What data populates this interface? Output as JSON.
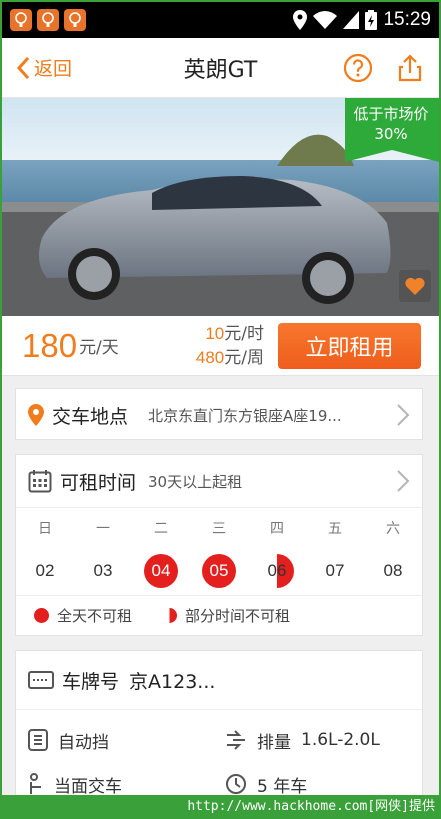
{
  "statusbar": {
    "time": "15:29",
    "app_icons": [
      "app-icon",
      "app-icon",
      "app-icon"
    ]
  },
  "titlebar": {
    "back_label": "返回",
    "title": "英朗GT"
  },
  "hero": {
    "ribbon_line1": "低于市场价",
    "ribbon_line2": "30%"
  },
  "price": {
    "day_value": "180",
    "day_unit": "元/天",
    "hour_value": "10",
    "hour_unit": "元/时",
    "week_value": "480",
    "week_unit": "元/周",
    "rent_button": "立即租用"
  },
  "pickup": {
    "label": "交车地点",
    "address": "北京东直门东方银座A座19..."
  },
  "availability": {
    "label": "可租时间",
    "note": "30天以上起租",
    "weekdays": [
      "日",
      "一",
      "二",
      "三",
      "四",
      "五",
      "六"
    ],
    "dates": [
      {
        "day": "02",
        "status": "available"
      },
      {
        "day": "03",
        "status": "available"
      },
      {
        "day": "04",
        "status": "full"
      },
      {
        "day": "05",
        "status": "full"
      },
      {
        "day": "06",
        "status": "partial"
      },
      {
        "day": "07",
        "status": "available"
      },
      {
        "day": "08",
        "status": "available"
      }
    ],
    "legend_full": "全天不可租",
    "legend_partial": "部分时间不可租"
  },
  "specs": {
    "plate_label": "车牌号",
    "plate_value": "京A123...",
    "transmission": "自动挡",
    "displacement_label": "排量",
    "displacement_value": "1.6L-2.0L",
    "handover": "当面交车",
    "age": "5 年车"
  },
  "footer": {
    "watermark": "http://www.hackhome.com[网侠]提供"
  },
  "colors": {
    "accent": "#f07c1b",
    "unavailable": "#e4201e",
    "ribbon": "#2eaa3a"
  }
}
